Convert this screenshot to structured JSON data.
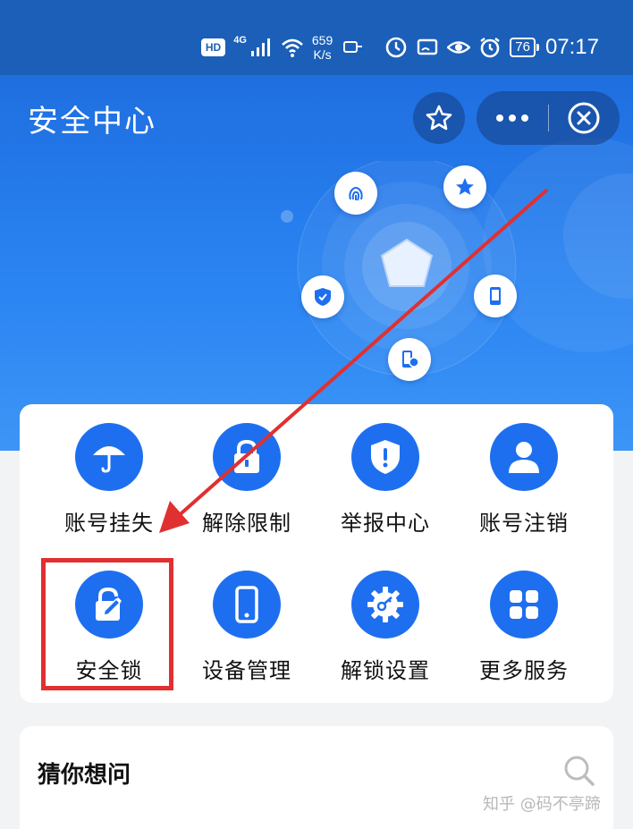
{
  "status_bar": {
    "hd_badge": "HD",
    "network_type": "4G",
    "speed_value": "659",
    "speed_unit": "K/s",
    "battery_level": "76",
    "time": "07:17"
  },
  "header": {
    "title": "安全中心",
    "star_icon": "star-icon",
    "more_icon": "more-dots-icon",
    "close_icon": "close-circle-icon"
  },
  "hero_orbit_icons": [
    "fingerprint-icon",
    "star-badge-icon",
    "shield-check-icon",
    "phone-icon",
    "device-user-icon",
    "pentagon-icon"
  ],
  "services": {
    "items": [
      {
        "label": "账号挂失",
        "icon": "umbrella-icon"
      },
      {
        "label": "解除限制",
        "icon": "unlock-padlock-icon"
      },
      {
        "label": "举报中心",
        "icon": "shield-alert-icon"
      },
      {
        "label": "账号注销",
        "icon": "user-icon"
      },
      {
        "label": "安全锁",
        "icon": "lock-edit-icon"
      },
      {
        "label": "设备管理",
        "icon": "phone-icon"
      },
      {
        "label": "解锁设置",
        "icon": "gear-key-icon"
      },
      {
        "label": "更多服务",
        "icon": "grid-apps-icon"
      }
    ]
  },
  "guess": {
    "title": "猜你想问",
    "search_icon": "search-icon"
  },
  "watermark": "知乎 @码不亭蹄",
  "colors": {
    "status_bar": "#1b5fb8",
    "hero_blue": "#2a84f2",
    "service_icon_blue": "#1e6ff0",
    "annotation_red": "#e03030",
    "page_bg": "#f2f3f5"
  }
}
